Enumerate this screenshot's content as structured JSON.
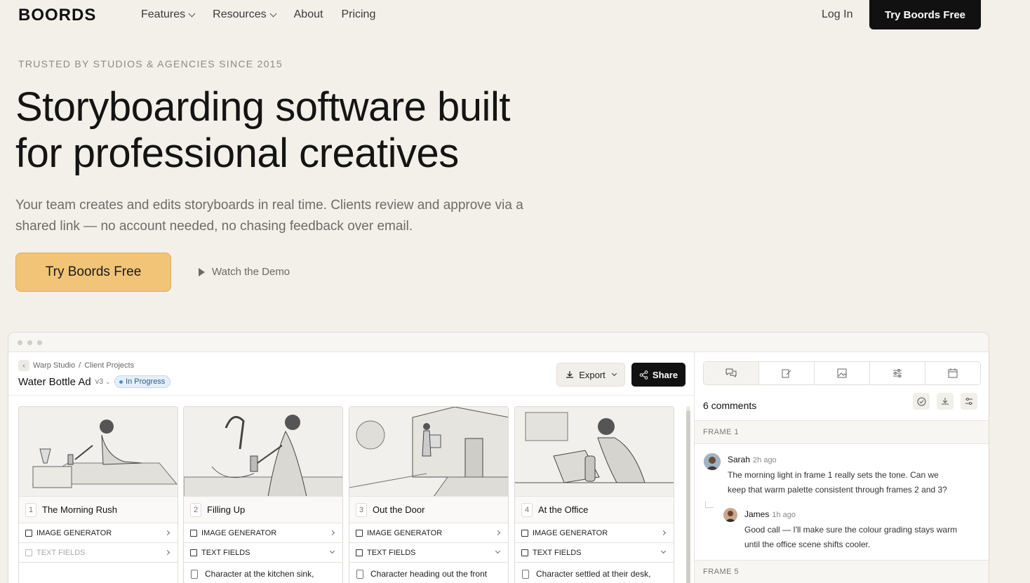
{
  "nav": {
    "logo": "BOORDS",
    "links": [
      {
        "label": "Features",
        "has_menu": true
      },
      {
        "label": "Resources",
        "has_menu": true
      },
      {
        "label": "About",
        "has_menu": false
      },
      {
        "label": "Pricing",
        "has_menu": false
      }
    ],
    "login": "Log In",
    "cta": "Try Boords Free"
  },
  "hero": {
    "eyebrow": "TRUSTED BY STUDIOS & AGENCIES SINCE 2015",
    "title_line1": "Storyboarding software built",
    "title_line2": "for professional creatives",
    "subtitle": "Your team creates and edits storyboards in real time. Clients review and approve via a shared link — no account needed, no chasing feedback over email.",
    "primary_cta": "Try Boords Free",
    "demo_cta": "Watch the Demo"
  },
  "app": {
    "breadcrumb": [
      "Warp Studio",
      "Client Projects"
    ],
    "breadcrumb_sep": "/",
    "project_title": "Water Bottle Ad",
    "version": "v3",
    "status": "In Progress",
    "export_label": "Export",
    "share_label": "Share",
    "frames": [
      {
        "num": "1",
        "title": "The Morning Rush",
        "row1": "IMAGE GENERATOR",
        "row2": "TEXT FIELDS",
        "row2_dim": true,
        "note": ""
      },
      {
        "num": "2",
        "title": "Filling Up",
        "row1": "IMAGE GENERATOR",
        "row2": "TEXT FIELDS",
        "row2_dim": false,
        "note": "Character at the kitchen sink,"
      },
      {
        "num": "3",
        "title": "Out the Door",
        "row1": "IMAGE GENERATOR",
        "row2": "TEXT FIELDS",
        "row2_dim": false,
        "note": "Character heading out the front"
      },
      {
        "num": "4",
        "title": "At the Office",
        "row1": "IMAGE GENERATOR",
        "row2": "TEXT FIELDS",
        "row2_dim": false,
        "note": "Character settled at their desk,"
      }
    ]
  },
  "comments": {
    "title": "6 comments",
    "frame1_label": "FRAME 1",
    "frame5_label": "FRAME 5",
    "items": [
      {
        "name": "Sarah",
        "time": "2h ago",
        "text_line1": "The morning light in frame 1 really sets the tone. Can we",
        "text_line2": "keep that warm palette consistent through frames 2 and 3?"
      },
      {
        "name": "James",
        "time": "1h ago",
        "text_line1": "Good call — I'll make sure the colour grading stays warm",
        "text_line2": "until the office scene shifts cooler."
      }
    ]
  },
  "colors": {
    "background": "#f2f0e9",
    "primary_cta": "#f1c477",
    "dark": "#111111",
    "badge": "#4a90cf"
  }
}
